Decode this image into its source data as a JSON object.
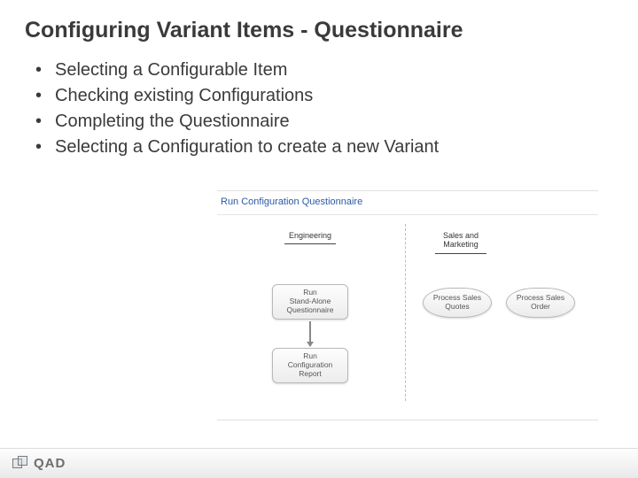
{
  "title": "Configuring Variant Items - Questionnaire",
  "bullets": [
    "Selecting a Configurable Item",
    "Checking existing Configurations",
    "Completing the Questionnaire",
    "Selecting a Configuration to create a new Variant"
  ],
  "diagram": {
    "heading": "Run Configuration Questionnaire",
    "lanes": {
      "engineering": "Engineering",
      "sales_marketing": "Sales and\nMarketing"
    },
    "nodes": {
      "run_standalone": "Run\nStand-Alone\nQuestionnaire",
      "run_config_report": "Run\nConfiguration\nReport",
      "process_sales_quotes": "Process Sales\nQuotes",
      "process_sales_order": "Process Sales\nOrder"
    }
  },
  "footer": {
    "brand": "QAD"
  }
}
